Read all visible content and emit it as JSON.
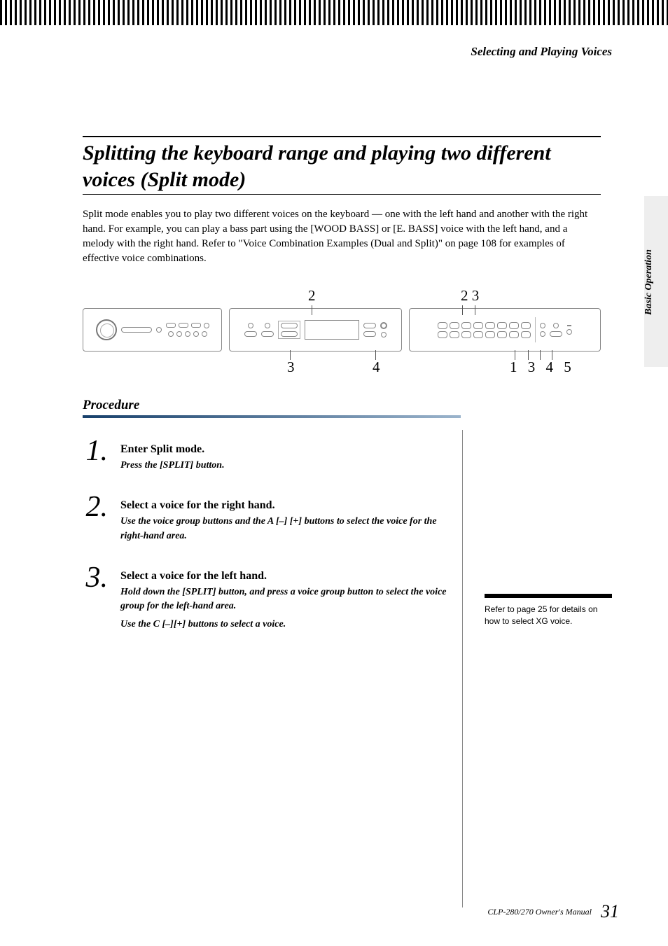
{
  "header": {
    "section": "Selecting and Playing Voices",
    "side_tab": "Basic Operation"
  },
  "title": "Splitting the keyboard range and playing two different voices (Split mode)",
  "intro": "Split mode enables you to play two different voices on the keyboard — one with the left hand and another with the right hand. For example, you can play a bass part using the [WOOD BASS] or [E. BASS] voice with the left hand, and a melody with the right hand. Refer to \"Voice Combination Examples (Dual and Split)\" on page 108 for examples of effective voice combinations.",
  "callouts": {
    "top_left": "2",
    "top_right": "2 3",
    "bottom_left": "3",
    "bottom_mid": "4",
    "bottom_right": "1 3 4 5"
  },
  "procedure_heading": "Procedure",
  "steps": [
    {
      "num": "1.",
      "title": "Enter Split mode.",
      "body1": "Press the [SPLIT] button.",
      "body2": ""
    },
    {
      "num": "2.",
      "title": "Select a voice for the right hand.",
      "body1": "Use the voice group buttons and the A [–] [+] buttons to select the voice for the right-hand area.",
      "body2": ""
    },
    {
      "num": "3.",
      "title": "Select a voice for the left hand.",
      "body1": "Hold down the [SPLIT] button, and press a voice group button to select the voice group for the left-hand area.",
      "body2": "Use the C [–][+] buttons to select a voice."
    }
  ],
  "sidebar_note": "Refer to page 25 for details on how to select XG voice.",
  "footer": {
    "manual": "CLP-280/270 Owner's Manual",
    "page": "31"
  }
}
